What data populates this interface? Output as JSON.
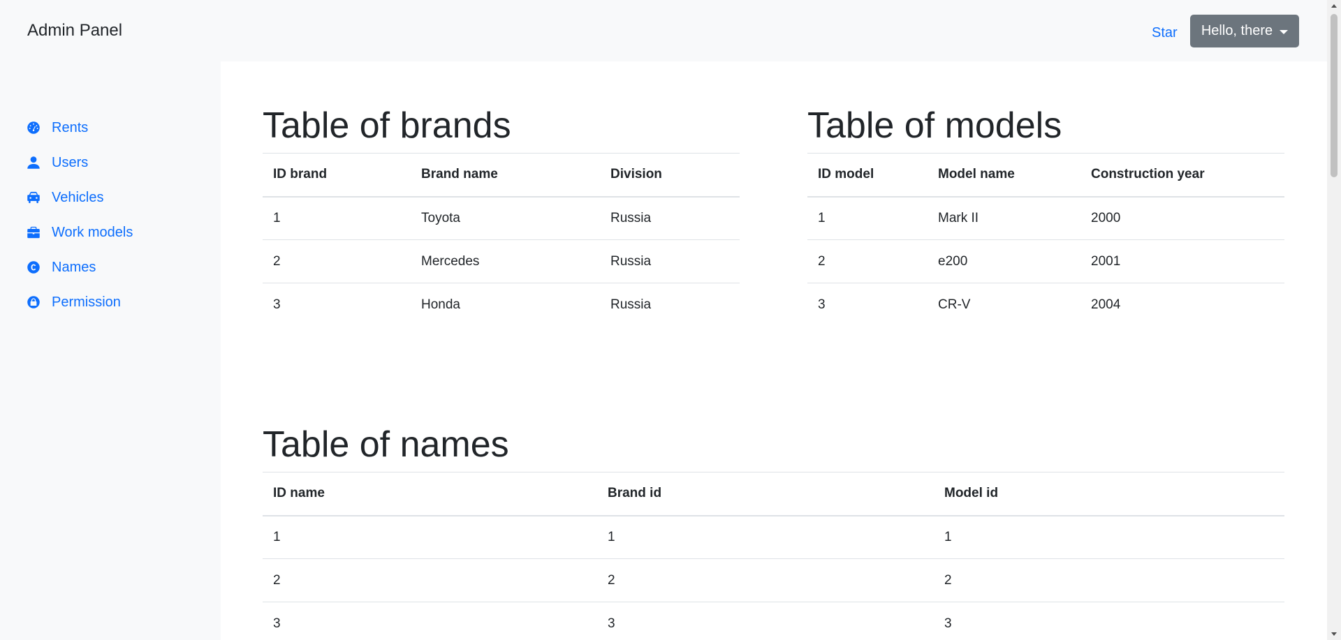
{
  "header": {
    "brand": "Admin Panel",
    "star_link": "Star",
    "user_menu": "Hello, there"
  },
  "sidebar": {
    "items": [
      {
        "label": "Rents",
        "icon": "speedometer-icon"
      },
      {
        "label": "Users",
        "icon": "user-icon"
      },
      {
        "label": "Vehicles",
        "icon": "car-icon"
      },
      {
        "label": "Work models",
        "icon": "briefcase-icon"
      },
      {
        "label": "Names",
        "icon": "copyright-icon"
      },
      {
        "label": "Permission",
        "icon": "lock-icon"
      }
    ]
  },
  "brands": {
    "title": "Table of brands",
    "columns": [
      "ID brand",
      "Brand name",
      "Division"
    ],
    "rows": [
      [
        "1",
        "Toyota",
        "Russia"
      ],
      [
        "2",
        "Mercedes",
        "Russia"
      ],
      [
        "3",
        "Honda",
        "Russia"
      ]
    ]
  },
  "models": {
    "title": "Table of models",
    "columns": [
      "ID model",
      "Model name",
      "Construction year"
    ],
    "rows": [
      [
        "1",
        "Mark II",
        "2000"
      ],
      [
        "2",
        "e200",
        "2001"
      ],
      [
        "3",
        "CR-V",
        "2004"
      ]
    ]
  },
  "names": {
    "title": "Table of names",
    "columns": [
      "ID name",
      "Brand id",
      "Model id"
    ],
    "rows": [
      [
        "1",
        "1",
        "1"
      ],
      [
        "2",
        "2",
        "2"
      ],
      [
        "3",
        "3",
        "3"
      ]
    ]
  },
  "colors": {
    "link": "#0d6efd",
    "button_bg": "#6c757d",
    "sidebar_bg": "#f8f9fa"
  }
}
